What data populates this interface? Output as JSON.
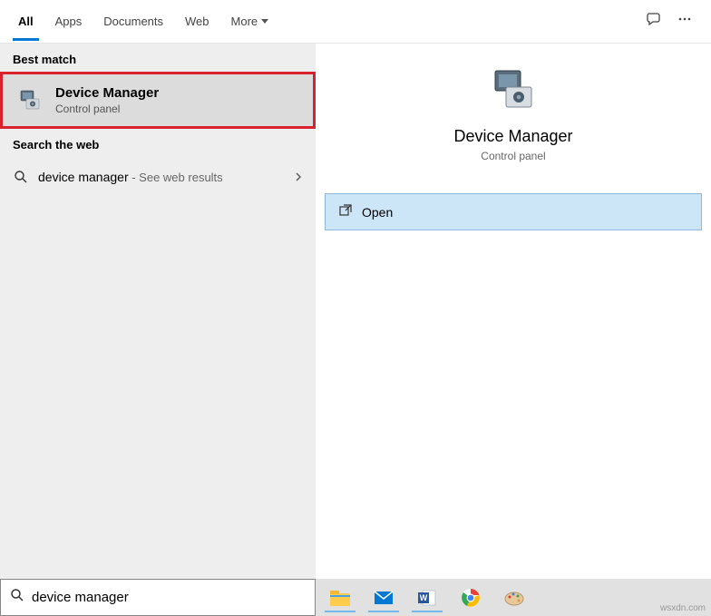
{
  "tabs": {
    "all": "All",
    "apps": "Apps",
    "documents": "Documents",
    "web": "Web",
    "more": "More"
  },
  "sections": {
    "best_match": "Best match",
    "search_web": "Search the web"
  },
  "best_match": {
    "title": "Device Manager",
    "subtitle": "Control panel"
  },
  "web_result": {
    "query": "device manager",
    "suffix": " - See web results"
  },
  "preview": {
    "title": "Device Manager",
    "subtitle": "Control panel"
  },
  "open_button": "Open",
  "search": {
    "value": "device manager"
  },
  "watermark": "wsxdn.com"
}
